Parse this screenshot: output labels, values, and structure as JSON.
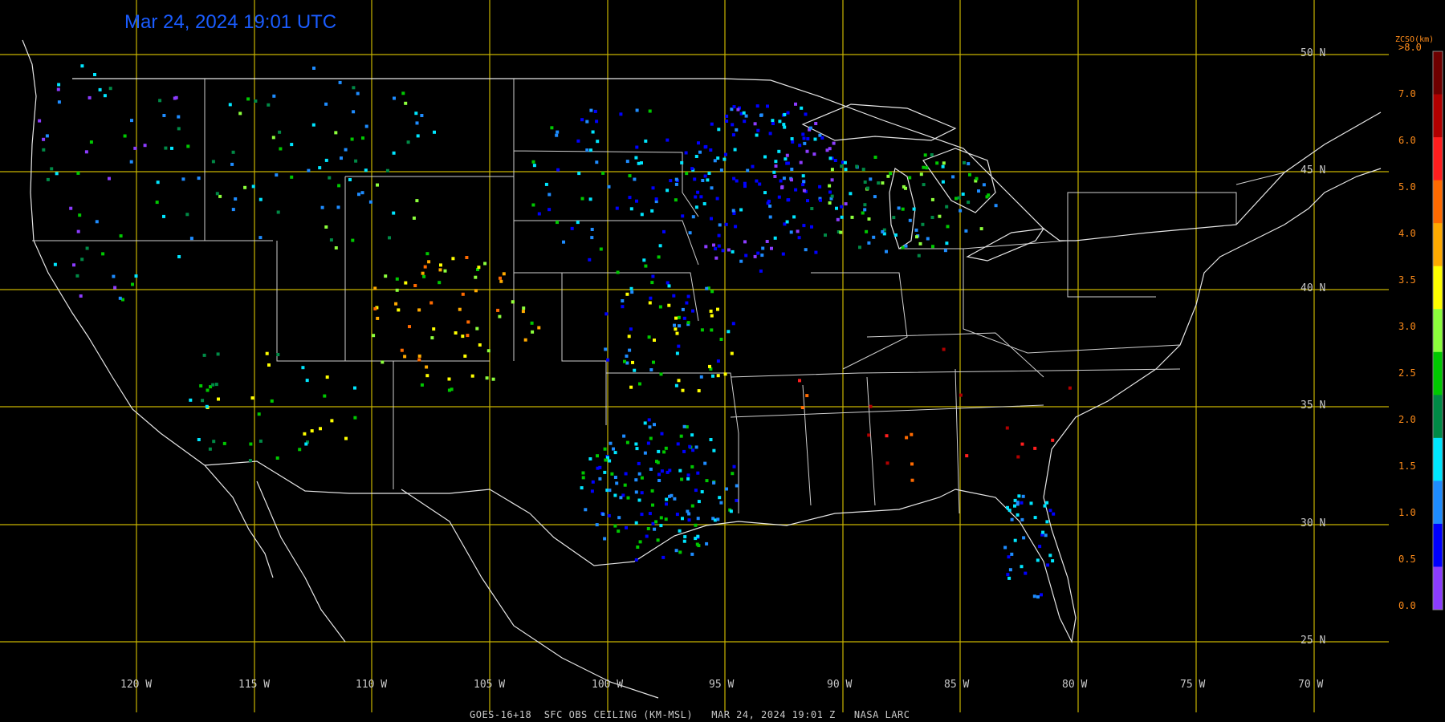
{
  "title": "Mar 24, 2024 19:01 UTC",
  "footer": "GOES-16+18  SFC OBS CEILING (KM-MSL)   MAR 24, 2024 19:01 Z   NASA LARC",
  "grid": {
    "lat_labels": [
      "50 N",
      "45 N",
      "40 N",
      "35 N",
      "30 N",
      "25 N"
    ],
    "lon_labels": [
      "120 W",
      "115 W",
      "110 W",
      "105 W",
      "100 W",
      "95 W",
      "90 W",
      "85 W",
      "80 W",
      "75 W",
      "70 W"
    ]
  },
  "legend": {
    "title": "ZCSO(km)",
    "ticks": [
      ">8.0",
      "7.0",
      "6.0",
      "5.0",
      "4.0",
      "3.5",
      "3.0",
      "2.5",
      "2.0",
      "1.5",
      "1.0",
      "0.5",
      "0.0"
    ],
    "colors": [
      "#6e0000",
      "#b00000",
      "#ff1e1e",
      "#ff6a00",
      "#ffaa00",
      "#ffff00",
      "#8cff3c",
      "#00c800",
      "#008a46",
      "#00e6ff",
      "#1e8cff",
      "#0000ff",
      "#8c3cff"
    ]
  },
  "colors": {
    "grid_line": "#c8b400",
    "coast_line": "#e6e6e6",
    "title": "#1a5cff",
    "legend_text": "#ff8c1a"
  }
}
